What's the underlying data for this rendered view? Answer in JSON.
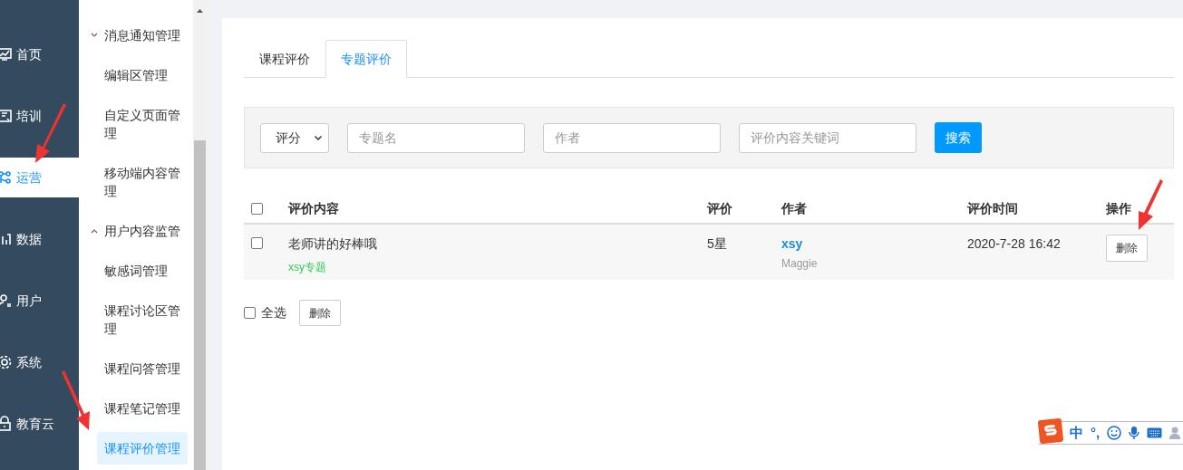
{
  "nav": {
    "items": [
      {
        "label": "首页",
        "selected": false
      },
      {
        "label": "培训",
        "selected": false
      },
      {
        "label": "运营",
        "selected": true
      },
      {
        "label": "数据",
        "selected": false
      },
      {
        "label": "用户",
        "selected": false
      },
      {
        "label": "系统",
        "selected": false
      },
      {
        "label": "教育云",
        "selected": false
      }
    ]
  },
  "submenu": {
    "groups": [
      {
        "label": "消息通知管理",
        "expanded": false,
        "children": [
          {
            "label": "编辑区管理",
            "selected": false
          },
          {
            "label": "自定义页面管理",
            "selected": false
          },
          {
            "label": "移动端内容管理",
            "selected": false
          }
        ]
      },
      {
        "label": "用户内容监管",
        "expanded": true,
        "children": [
          {
            "label": "敏感词管理",
            "selected": false
          },
          {
            "label": "课程讨论区管理",
            "selected": false
          },
          {
            "label": "课程问答管理",
            "selected": false
          },
          {
            "label": "课程笔记管理",
            "selected": false
          },
          {
            "label": "课程评价管理",
            "selected": true
          }
        ]
      }
    ]
  },
  "tabs": [
    {
      "label": "课程评价",
      "selected": false
    },
    {
      "label": "专题评价",
      "selected": true
    }
  ],
  "filters": {
    "select": "评分",
    "fields": [
      {
        "placeholder": "专题名"
      },
      {
        "placeholder": "作者"
      },
      {
        "placeholder": "评价内容关键词"
      }
    ],
    "search_button": "搜索"
  },
  "table": {
    "columns": [
      "评价内容",
      "评价",
      "作者",
      "评价时间",
      "操作"
    ],
    "header_checked": false,
    "rows": [
      {
        "checked": false,
        "content": "老师讲的好棒哦",
        "topic": "xsy专题",
        "rating": "5星",
        "author": "xsy",
        "author_name": "Maggie",
        "time": "2020-7-28 16:42",
        "action": "删除"
      }
    ]
  },
  "footer": {
    "select_all": "全选",
    "select_all_checked": false,
    "delete_button": "删除"
  },
  "ime": {
    "mode": "中",
    "punct": "°,"
  }
}
